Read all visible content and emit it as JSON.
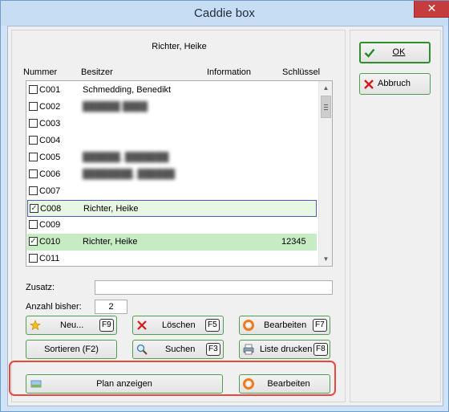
{
  "window": {
    "title": "Caddie box",
    "close": "✕"
  },
  "header_name": "Richter, Heike",
  "columns": [
    "Nummer",
    "Besitzer",
    "Information",
    "Schlüssel"
  ],
  "rows": [
    {
      "nr": "C001",
      "owner": "Schmedding, Benedikt",
      "info": "",
      "key": "",
      "checked": false,
      "blur": false
    },
    {
      "nr": "C002",
      "owner": "██████ ████",
      "info": "",
      "key": "",
      "checked": false,
      "blur": true
    },
    {
      "nr": "C003",
      "owner": "",
      "info": "",
      "key": "",
      "checked": false,
      "blur": false
    },
    {
      "nr": "C004",
      "owner": "",
      "info": "",
      "key": "",
      "checked": false,
      "blur": false
    },
    {
      "nr": "C005",
      "owner": "██████, ███████",
      "info": "",
      "key": "",
      "checked": false,
      "blur": true
    },
    {
      "nr": "C006",
      "owner": "████████, ██████",
      "info": "",
      "key": "",
      "checked": false,
      "blur": true
    },
    {
      "nr": "C007",
      "owner": "",
      "info": "",
      "key": "",
      "checked": false,
      "blur": false
    },
    {
      "nr": "C008",
      "owner": "Richter, Heike",
      "info": "",
      "key": "",
      "checked": true,
      "blur": false
    },
    {
      "nr": "C009",
      "owner": "",
      "info": "",
      "key": "",
      "checked": false,
      "blur": false
    },
    {
      "nr": "C010",
      "owner": "Richter, Heike",
      "info": "",
      "key": "12345",
      "checked": true,
      "blur": false
    },
    {
      "nr": "C011",
      "owner": "",
      "info": "",
      "key": "",
      "checked": false,
      "blur": false
    }
  ],
  "zusatz": {
    "label": "Zusatz:",
    "value": ""
  },
  "anzahl": {
    "label": "Anzahl bisher:",
    "value": "2"
  },
  "buttons": {
    "neu": {
      "label": "Neu...",
      "key": "F9"
    },
    "loeschen": {
      "label": "Löschen",
      "key": "F5"
    },
    "bearbeiten1": {
      "label": "Bearbeiten",
      "key": "F7"
    },
    "sortieren": {
      "label": "Sortieren (F2)"
    },
    "suchen": {
      "label": "Suchen",
      "key": "F3"
    },
    "liste": {
      "label": "Liste drucken",
      "key": "F8"
    },
    "plan": {
      "label": "Plan anzeigen"
    },
    "bearbeiten2": {
      "label": "Bearbeiten"
    },
    "ok": {
      "label": "OK"
    },
    "abbruch": {
      "label": "Abbruch"
    }
  },
  "icons": {
    "ok": "check-icon",
    "abbruch": "cross-icon",
    "neu": "star-icon",
    "loeschen": "cross-icon",
    "bearbeiten": "lifebuoy-icon",
    "suchen": "magnifier-icon",
    "liste": "printer-icon",
    "plan": "map-icon"
  },
  "colors": {
    "accent_green": "#4f9f4f",
    "selected_row": "#c7ecc3",
    "highlight": "#e8473f"
  }
}
